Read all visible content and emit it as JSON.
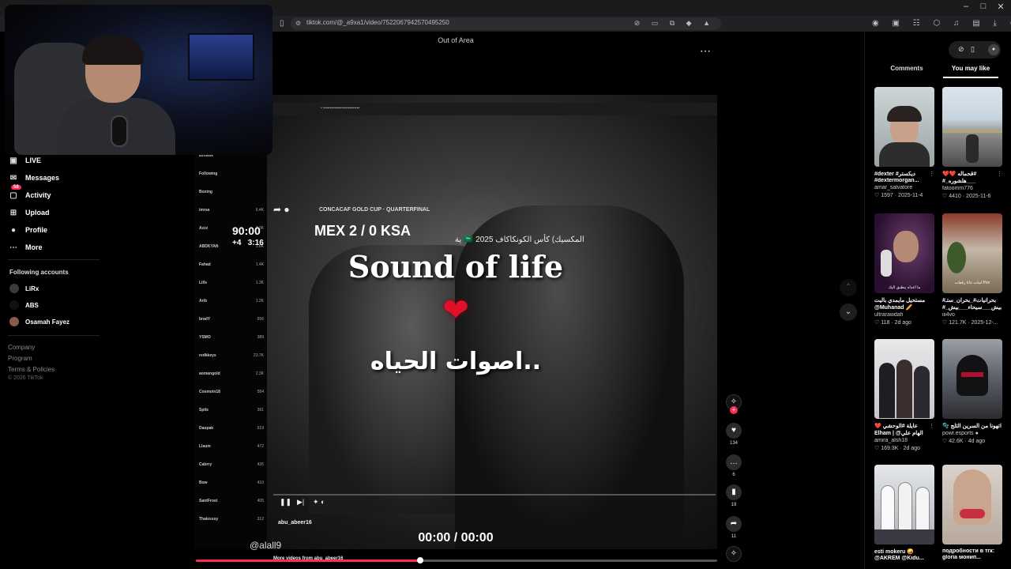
{
  "browser": {
    "url": "tiktok.com/@_a9xa1/video/7522067942570495250",
    "min_icon": "–",
    "max_icon": "□",
    "close_icon": "✕"
  },
  "sidebar": {
    "items": [
      {
        "label": "LIVE",
        "icon": "live-icon"
      },
      {
        "label": "Messages",
        "icon": "messages-icon"
      },
      {
        "label": "Activity",
        "icon": "activity-icon",
        "badge": "58"
      },
      {
        "label": "Upload",
        "icon": "upload-icon"
      },
      {
        "label": "Profile",
        "icon": "profile-icon"
      },
      {
        "label": "More",
        "icon": "more-icon"
      }
    ],
    "following_label": "Following accounts",
    "accounts": [
      "LiRx",
      "ABS",
      "Osamah Fayez"
    ],
    "footer": [
      "Company",
      "Program",
      "Terms & Policies",
      "© 2026 TikTok"
    ]
  },
  "video": {
    "top_label": "Out of Area",
    "scoreboard": {
      "competition": "CONCACAF GOLD CUP · QUARTERFINAL",
      "clock": "90:00",
      "teams": "MEX 2 / 0 KSA",
      "added": "+4",
      "added_clock": "3:16",
      "arabic_caption": "ية 🇸🇦 المكسيك) كأس الكونكاكاف 2025"
    },
    "overlay_title": "Sound of life",
    "overlay_heart": "❤",
    "overlay_arabic": "اصوات الحياه..",
    "inner_author": "abu_abeer16",
    "inner_more": "More videos from abu_abeer16",
    "watermark": "@alall9",
    "time": "00:00 / 00:00",
    "progress_fraction": 0.43,
    "inner_side": [
      {
        "t": "Browse",
        "n": ""
      },
      {
        "t": "Following",
        "n": ""
      },
      {
        "t": "Boxing",
        "n": ""
      },
      {
        "t": "imrsa",
        "n": "6.4K"
      },
      {
        "t": "Azzz",
        "n": "2.3K"
      },
      {
        "t": "ABDKYAN",
        "n": "1.8K"
      },
      {
        "t": "Fahad",
        "n": "1.4K"
      },
      {
        "t": "Lills",
        "n": "1.3K"
      },
      {
        "t": "Arib",
        "n": "1.2K"
      },
      {
        "t": "bradY",
        "n": "656"
      },
      {
        "t": "YSMO",
        "n": "389"
      },
      {
        "t": "redkkeys",
        "n": "23.7K"
      },
      {
        "t": "aomangold",
        "n": "2.3K"
      },
      {
        "t": "Cosmoin18",
        "n": "584"
      },
      {
        "t": "Spils",
        "n": "391"
      },
      {
        "t": "Daupak",
        "n": "519"
      },
      {
        "t": "Llaum",
        "n": "472"
      },
      {
        "t": "Cabrry",
        "n": "426"
      },
      {
        "t": "Bow",
        "n": "410"
      },
      {
        "t": "SantFrost",
        "n": "405"
      },
      {
        "t": "Thalesssy",
        "n": "312"
      }
    ]
  },
  "rail": {
    "likes": "134",
    "comments": "6",
    "saves": "19",
    "shares": "11"
  },
  "panel": {
    "tab_comments": "Comments",
    "tab_you_may_like": "You may like",
    "cards": [
      {
        "title": "#dexter #ديكستر",
        "title2": "#dextermorgan...",
        "user": "amar_salvatore",
        "likes": "1597",
        "date": "2025-11-4",
        "caption": ""
      },
      {
        "title": "❤️❤️ قحماله#",
        "title2": "#_هلشوره___",
        "user": "fatoomm776",
        "likes": "4410",
        "date": "2025-11-6",
        "caption": ""
      },
      {
        "title": "مستحيل مايمدي باليت",
        "title2": "@Muhanad 🥖",
        "user": "ultrarawdah",
        "likes": "118",
        "date": "2d ago",
        "caption": "ما اعداه ينطبق اليك"
      },
      {
        "title": "#بحرانيات#_بحران_ستـ",
        "title2": "#_بيش___سيحاء___بيش",
        "user": "iii4vo",
        "likes": "121.7K",
        "date": "2025-12-...",
        "caption": "لبنات تتانا رقعات Pov"
      },
      {
        "title": "❤️ عايلة #الوحشي",
        "title2": "Elham | @الهام علي",
        "user": "amira_alsh18",
        "likes": "169.3K",
        "date": "2d ago",
        "caption": ""
      },
      {
        "title": "🫧 اتهونا من السرين الثلج",
        "title2": "",
        "user": "powr.esports ●",
        "likes": "42.6K",
        "date": "4d ago",
        "caption": ""
      },
      {
        "title": "esti mokeru 🤪",
        "title2": "@AKREM @Kidu...",
        "user": "",
        "likes": "",
        "date": "",
        "caption": ""
      },
      {
        "title": "подробности в тгк:",
        "title2": "gloria монип...",
        "user": "",
        "likes": "",
        "date": "",
        "caption": ""
      }
    ]
  }
}
